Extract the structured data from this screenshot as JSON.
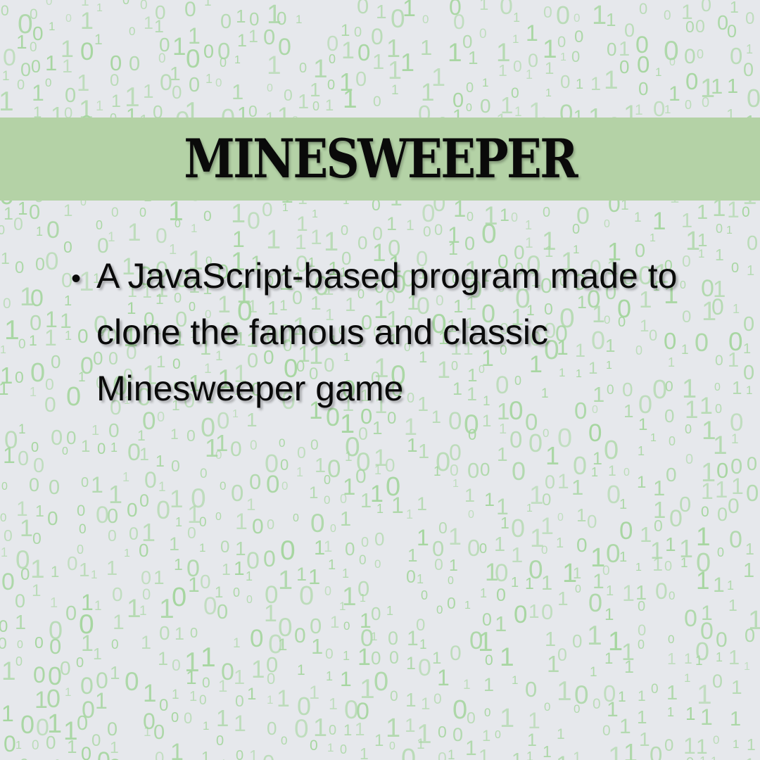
{
  "title": "MINESWEEPER",
  "bullets": [
    {
      "marker": "•",
      "text": "A JavaScript-based program made to clone the famous and classic Minesweeper game"
    }
  ],
  "colors": {
    "background": "#e6e8ec",
    "band": "#b4d2a6",
    "digits": "#a6d6a0",
    "text": "#0a0a0a"
  },
  "background_pattern": {
    "style": "falling binary digits",
    "glyphs": [
      "0",
      "1"
    ]
  }
}
